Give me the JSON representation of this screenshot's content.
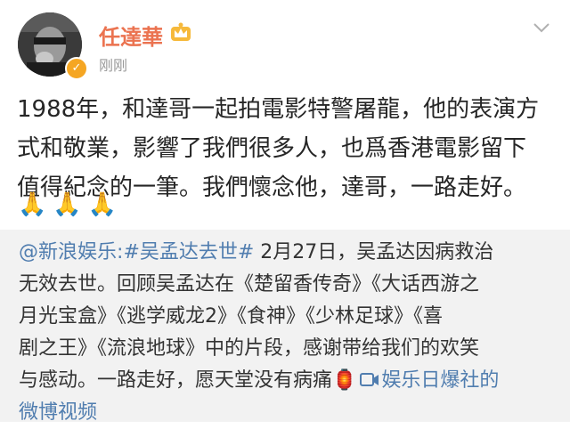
{
  "author": {
    "name": "任達華",
    "time": "刚刚",
    "badge_icon": "vip-crown-icon",
    "verified_icon": "verified-badge-icon"
  },
  "post": {
    "lines": [
      "1988年，和達哥一起拍電影特警屠龍，他的表演方",
      "式和敬業，影響了我們很多人，也爲香港電影留下",
      "值得紀念的一筆。我們懷念他，達哥，一路走好。"
    ],
    "emojis": [
      "🙏",
      "🙏",
      "🙏"
    ]
  },
  "repost": {
    "mention": "@新浪娱乐",
    "colon": ":",
    "hashtag": "#吴孟达去世#",
    "line1_rest": " 2月27日，吴孟达因病救治",
    "line2": "无效去世。回顾吴孟达在《楚留香传奇》《大话西游之",
    "line3": "月光宝盒》《逃学威龙2》《食神》《少林足球》《喜",
    "line4": "剧之王》《流浪地球》中的片段，感谢带给我们的欢笑",
    "line5_text": "与感动。一路走好，愿天堂没有病痛",
    "line5_emoji": "🏮",
    "video_icon": "video-icon",
    "video_link_a": "娱乐日爆社的",
    "video_link_b": "微博视频"
  },
  "colors": {
    "name": "#eb7350",
    "link": "#507daf",
    "repost_bg": "#f2f2f2",
    "time": "#999999"
  }
}
